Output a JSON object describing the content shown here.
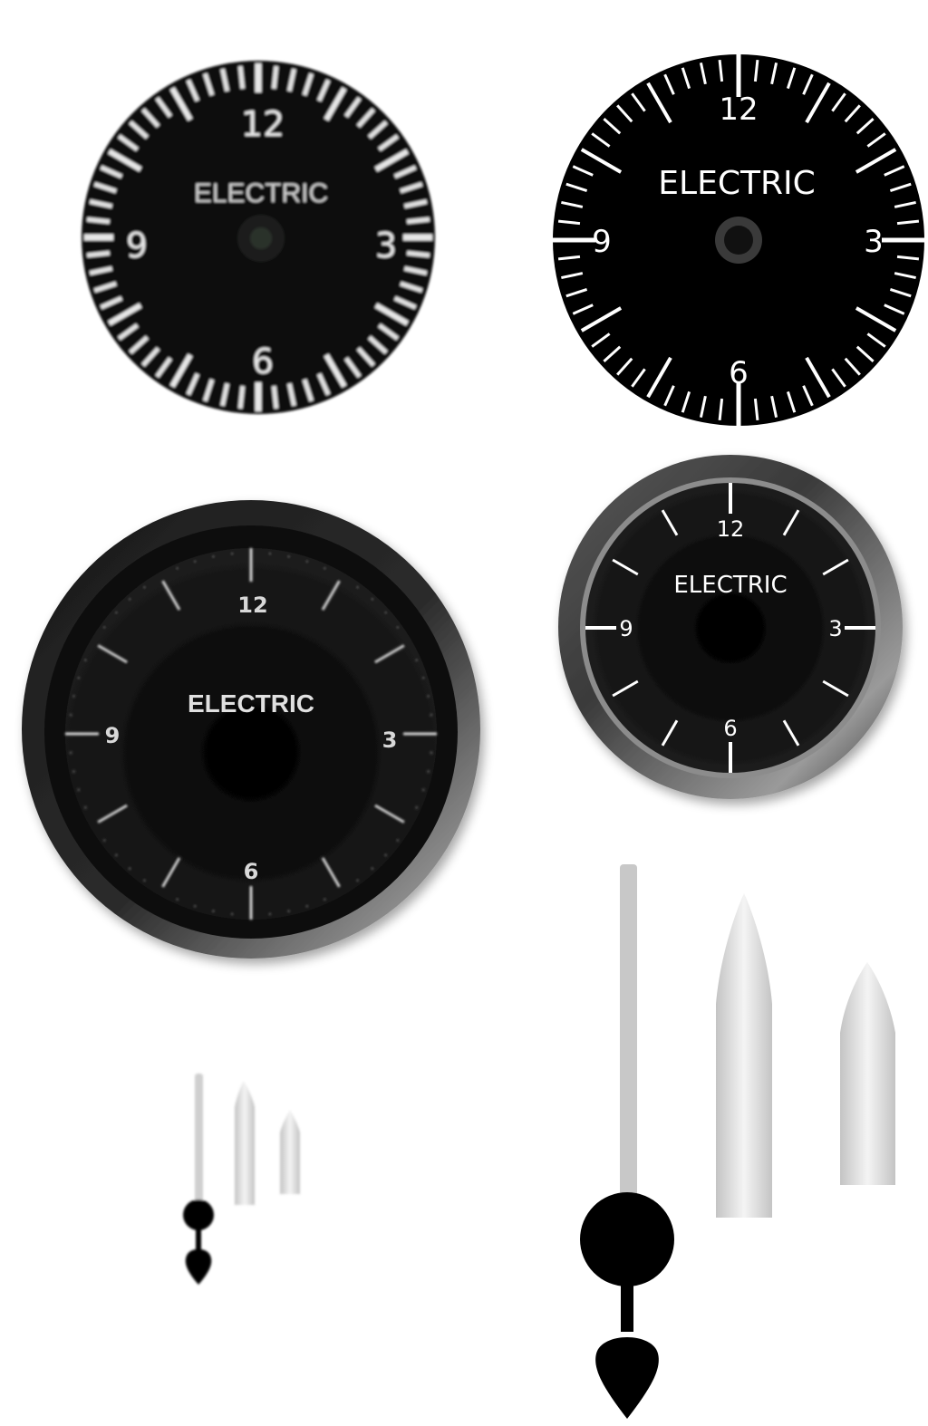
{
  "gauges": [
    {
      "id": "gauge-raster-small",
      "label": "ELECTRIC",
      "numerals": {
        "twelve": "12",
        "three": "3",
        "six": "6",
        "nine": "9"
      },
      "style": "dense-ticks-pixelated",
      "colors": {
        "face": "#0a0a0a",
        "marks": "#e6e6e6",
        "text": "#dcdcdc"
      }
    },
    {
      "id": "gauge-vector-dense",
      "label": "ELECTRIC",
      "numerals": {
        "twelve": "12",
        "three": "3",
        "six": "6",
        "nine": "9"
      },
      "style": "dense-ticks-vector",
      "colors": {
        "face": "#000000",
        "marks": "#ffffff",
        "text": "#ffffff"
      }
    },
    {
      "id": "gauge-bezel-raster",
      "label": "ELECTRIC",
      "numerals": {
        "twelve": "12",
        "three": "3",
        "six": "6",
        "nine": "9"
      },
      "style": "bezel-hour-ticks-blurred",
      "colors": {
        "face": "#151515",
        "bezel": "#2a2a2a",
        "marks": "#d8d8d8",
        "text": "#e0e0e0"
      }
    },
    {
      "id": "gauge-bezel-vector",
      "label": "ELECTRIC",
      "numerals": {
        "twelve": "12",
        "three": "3",
        "six": "6",
        "nine": "9"
      },
      "style": "bezel-hour-ticks-vector",
      "colors": {
        "face": "#0c0c0c",
        "bezel": "#7a7a7a",
        "marks": "#ffffff",
        "text": "#ffffff"
      }
    }
  ],
  "hands": [
    {
      "id": "hands-small-set",
      "pieces": [
        "second-hand",
        "minute-hand",
        "hour-hand"
      ]
    },
    {
      "id": "hands-large-set",
      "pieces": [
        "second-hand",
        "minute-hand",
        "hour-hand"
      ]
    }
  ],
  "colors": {
    "hand_fill": "#c8c8c8",
    "counterweight": "#000000"
  }
}
